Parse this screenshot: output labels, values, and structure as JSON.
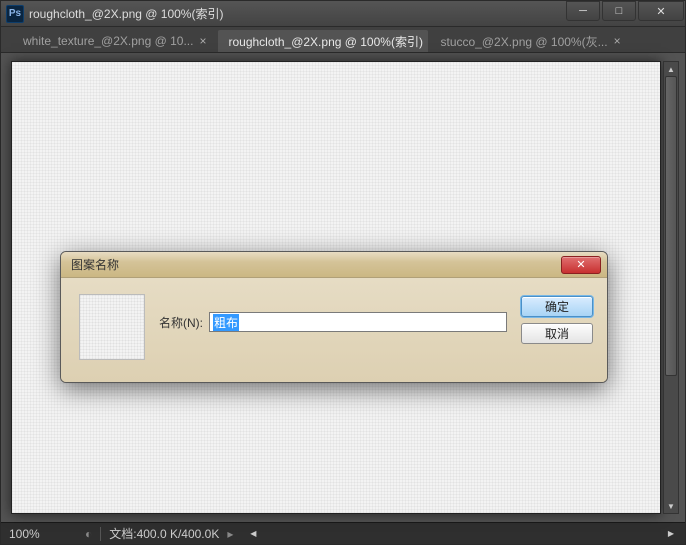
{
  "window": {
    "title": "roughcloth_@2X.png @ 100%(索引)"
  },
  "tabs": [
    {
      "label": "white_texture_@2X.png @ 10...",
      "active": false
    },
    {
      "label": "roughcloth_@2X.png @ 100%(索引)",
      "active": true
    },
    {
      "label": "stucco_@2X.png @ 100%(灰...",
      "active": false
    }
  ],
  "status": {
    "zoom": "100%",
    "doc_info": "文档:400.0 K/400.0K"
  },
  "dialog": {
    "title": "图案名称",
    "field_label": "名称(N):",
    "field_value": "粗布",
    "ok_label": "确定",
    "cancel_label": "取消"
  }
}
